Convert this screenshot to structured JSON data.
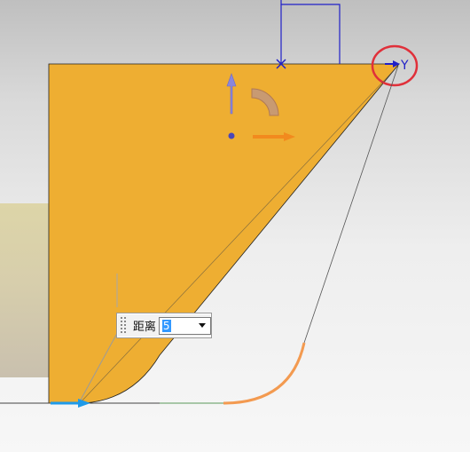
{
  "viewport": {
    "colors": {
      "face_fill": "#eeae32",
      "axis_blue": "#2020c8",
      "highlight_red": "#e0303a",
      "handle_orange": "#f28a1e",
      "curve_orange": "#f39a50",
      "arrow_cyan": "#1f9ae8"
    },
    "axis_label": "Y",
    "distance": {
      "label": "距离",
      "value": "5"
    }
  }
}
